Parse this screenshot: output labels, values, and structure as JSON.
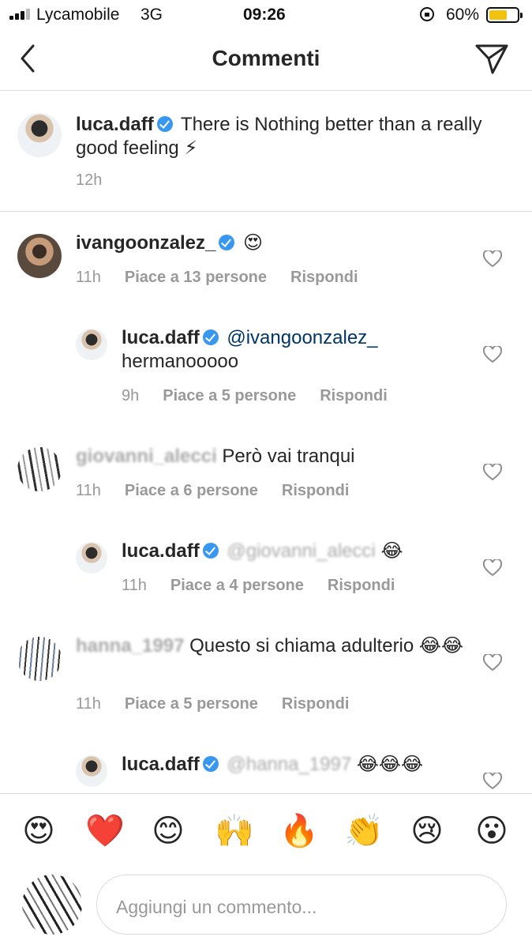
{
  "status": {
    "carrier": "Lycamobile",
    "network": "3G",
    "time": "09:26",
    "battery": "60%",
    "battery_level": 0.6
  },
  "header": {
    "title": "Commenti",
    "back_icon": "chevron-left-icon",
    "send_icon": "paper-plane-icon"
  },
  "caption": {
    "username": "luca.daff",
    "text": "There is Nothing better than a really good feeling ⚡",
    "time": "12h"
  },
  "comments": [
    {
      "username": "ivangoonzalez_",
      "verified": true,
      "text": "😍",
      "time": "11h",
      "likes": "Piace a 13 persone",
      "reply": "Rispondi"
    },
    {
      "username": "luca.daff",
      "verified": true,
      "mention": "@ivangoonzalez_",
      "text": "hermanooooo",
      "time": "9h",
      "likes": "Piace a 5 persone",
      "reply": "Rispondi"
    },
    {
      "username": "giovanni_alecci",
      "text": "Però vai tranqui",
      "time": "11h",
      "likes": "Piace a 6 persone",
      "reply": "Rispondi"
    },
    {
      "username": "luca.daff",
      "verified": true,
      "mention": "@giovanni_alecci",
      "text": "😂",
      "time": "11h",
      "likes": "Piace a 4 persone",
      "reply": "Rispondi"
    },
    {
      "username": "hanna_1997",
      "text": "Questo si chiama adulterio 😂😂",
      "time": "11h",
      "likes": "Piace a 5 persone",
      "reply": "Rispondi"
    },
    {
      "username": "luca.daff",
      "verified": true,
      "mention": "@hanna_1997",
      "text": "😂😂😂"
    }
  ],
  "emojis": [
    "😍",
    "❤️",
    "😊",
    "🙌",
    "🔥",
    "👏",
    "😢",
    "😮"
  ],
  "composer": {
    "placeholder": "Aggiungi un commento..."
  },
  "colors": {
    "accent": "#3897f0",
    "text": "#262626",
    "muted": "#999999",
    "divider": "#dbdbdb"
  }
}
